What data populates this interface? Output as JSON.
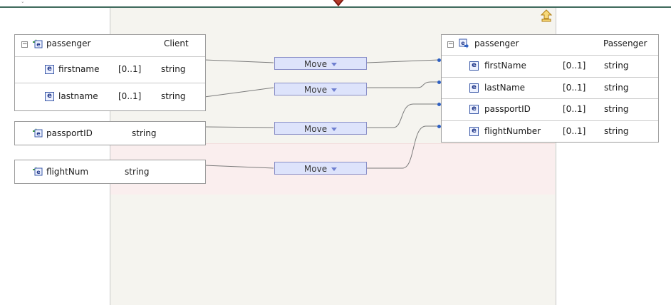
{
  "source": {
    "group": {
      "name": "passenger",
      "type": "Client",
      "fields": [
        {
          "name": "firstname",
          "cardinality": "[0..1]",
          "type": "string"
        },
        {
          "name": "lastname",
          "cardinality": "[0..1]",
          "type": "string"
        }
      ]
    },
    "passport": {
      "name": "passportID",
      "type": "string"
    },
    "flight": {
      "name": "flightNum",
      "type": "string"
    }
  },
  "transforms": [
    {
      "label": "Move"
    },
    {
      "label": "Move"
    },
    {
      "label": "Move"
    },
    {
      "label": "Move"
    }
  ],
  "target": {
    "name": "passenger",
    "type": "Passenger",
    "fields": [
      {
        "name": "firstName",
        "cardinality": "[0..1]",
        "type": "string"
      },
      {
        "name": "lastName",
        "cardinality": "[0..1]",
        "type": "string"
      },
      {
        "name": "passportID",
        "cardinality": "[0..1]",
        "type": "string"
      },
      {
        "name": "flightNumber",
        "cardinality": "[0..1]",
        "type": "string"
      }
    ]
  },
  "icons": {
    "element": "e",
    "up": "up-arrow-icon",
    "complex_type": "complex-element-icon",
    "source_element": "source-element-icon"
  },
  "colors": {
    "move_fill": "#dde3fb",
    "connector": "#2d5fc2",
    "wire": "#7b7b7b",
    "highlight_band": "#faeeee"
  }
}
